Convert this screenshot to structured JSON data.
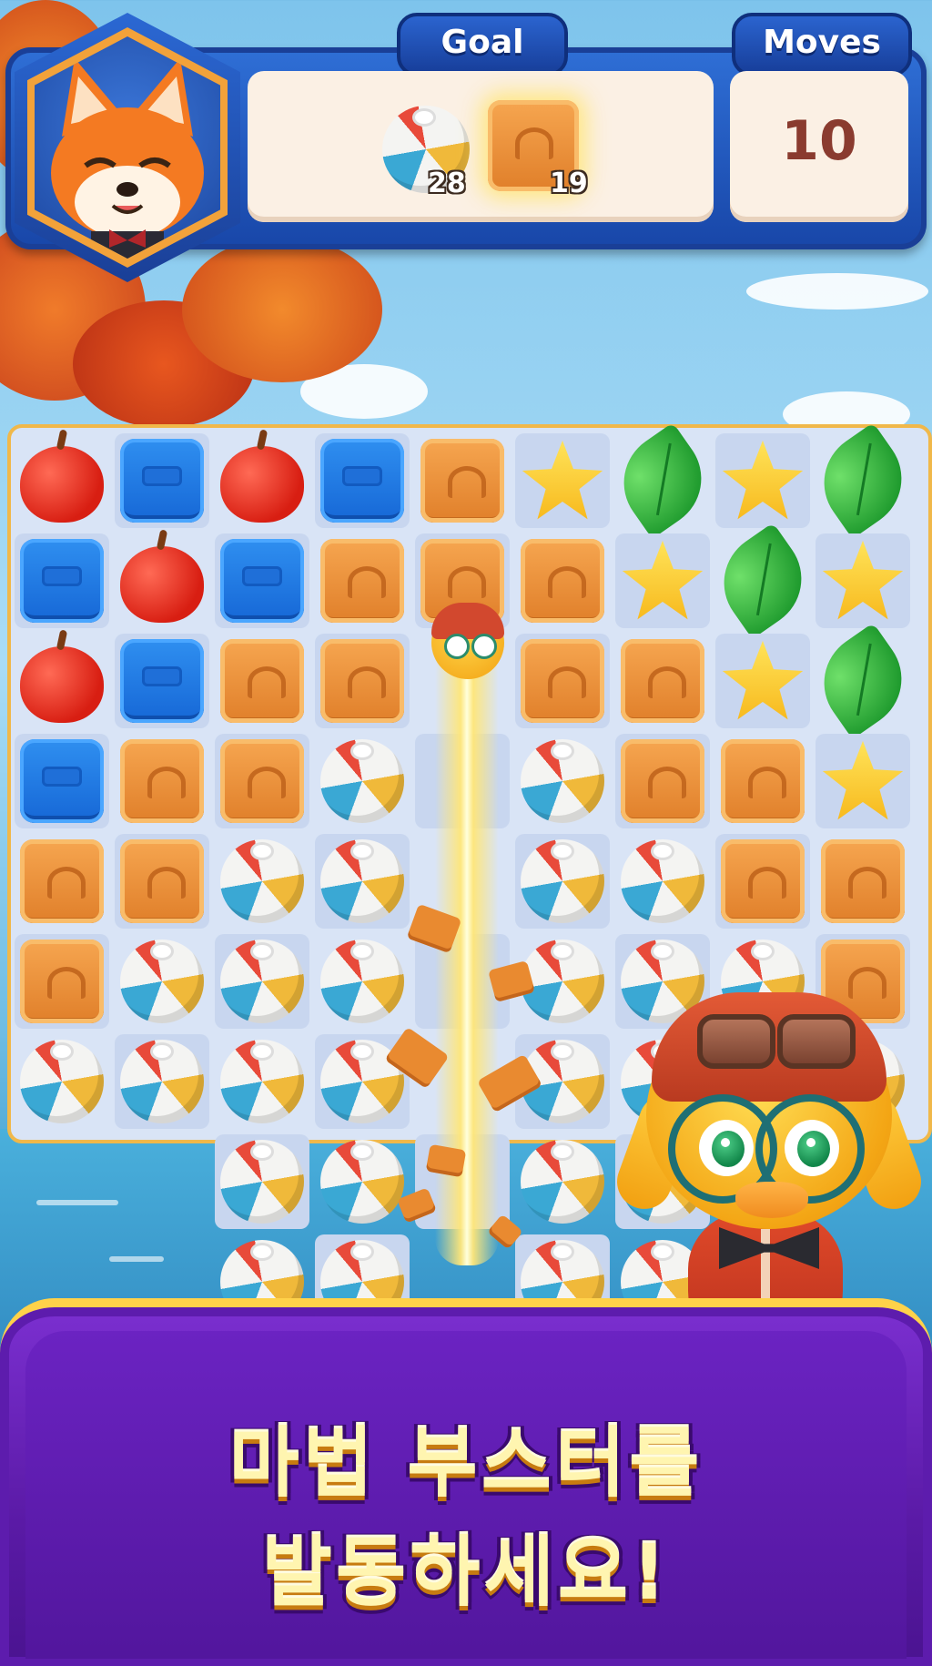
{
  "hud": {
    "goal_label": "Goal",
    "moves_label": "Moves",
    "moves_value": "10",
    "goals": [
      {
        "item": "beach-ball",
        "count": "28"
      },
      {
        "item": "wooden-crate",
        "count": "19"
      }
    ]
  },
  "board": {
    "rows": [
      [
        "apple",
        "block",
        "apple",
        "block",
        "crate",
        "star",
        "leaf",
        "star",
        "leaf"
      ],
      [
        "block",
        "apple",
        "block",
        "crate",
        "crate",
        "crate",
        "star",
        "leaf",
        "star"
      ],
      [
        "apple",
        "block",
        "crate",
        "crate",
        "duck",
        "crate",
        "crate",
        "star",
        "leaf"
      ],
      [
        "block",
        "crate",
        "crate",
        "ball",
        "beam",
        "ball",
        "crate",
        "crate",
        "star"
      ],
      [
        "crate",
        "crate",
        "ball",
        "ball",
        "beam",
        "ball",
        "ball",
        "crate",
        "crate"
      ],
      [
        "crate",
        "ball",
        "ball",
        "ball",
        "beam",
        "ball",
        "ball",
        "ball",
        "crate"
      ],
      [
        "ball",
        "ball",
        "ball",
        "ball",
        "beam",
        "ball",
        "ball",
        "",
        "ball"
      ],
      [
        "",
        "",
        "ball",
        "ball",
        "beam",
        "ball",
        "ball",
        "",
        ""
      ],
      [
        "",
        "",
        "ball",
        "ball",
        "beam",
        "ball",
        "ball",
        "",
        ""
      ]
    ]
  },
  "banner": {
    "line1": "마법 부스터를",
    "line2": "발동하세요!"
  },
  "colors": {
    "hud_blue": "#1846a8",
    "banner_purple": "#5a1aa6",
    "banner_border": "#ffd24a",
    "moves_text": "#8a3b2f"
  }
}
